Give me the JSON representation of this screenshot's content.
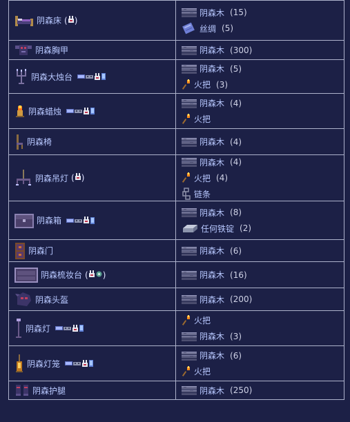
{
  "rows": [
    {
      "item": {
        "name": "阴森床",
        "icon": "spooky-bed-icon",
        "extra": "pre"
      },
      "ingredients": [
        {
          "name": "阴森木",
          "qty": "(15)",
          "icon": "wood-icon"
        },
        {
          "name": "丝绸",
          "qty": "(5)",
          "icon": "silk-icon"
        }
      ]
    },
    {
      "item": {
        "name": "阴森胸甲",
        "icon": "breastplate-icon"
      },
      "ingredients": [
        {
          "name": "阴森木",
          "qty": "(300)",
          "icon": "wood-icon"
        }
      ]
    },
    {
      "item": {
        "name": "阴森大烛台",
        "icon": "candelabra-icon",
        "extra": "platforms"
      },
      "ingredients": [
        {
          "name": "阴森木",
          "qty": "(5)",
          "icon": "wood-icon"
        },
        {
          "name": "火把",
          "qty": "(3)",
          "icon": "torch-icon"
        }
      ]
    },
    {
      "item": {
        "name": "阴森蜡烛",
        "icon": "candle-icon",
        "extra": "platforms"
      },
      "ingredients": [
        {
          "name": "阴森木",
          "qty": "(4)",
          "icon": "wood-icon"
        },
        {
          "name": "火把",
          "qty": "",
          "icon": "torch-icon"
        }
      ]
    },
    {
      "item": {
        "name": "阴森椅",
        "icon": "chair-icon"
      },
      "ingredients": [
        {
          "name": "阴森木",
          "qty": "(4)",
          "icon": "wood-icon"
        }
      ]
    },
    {
      "item": {
        "name": "阴森吊灯",
        "icon": "chandelier-icon",
        "extra": "pre"
      },
      "ingredients": [
        {
          "name": "阴森木",
          "qty": "(4)",
          "icon": "wood-icon"
        },
        {
          "name": "火把",
          "qty": "(4)",
          "icon": "torch-icon"
        },
        {
          "name": "链条",
          "qty": "",
          "icon": "chain-icon"
        }
      ]
    },
    {
      "item": {
        "name": "阴森箱",
        "icon": "chest-icon",
        "extra": "platforms"
      },
      "ingredients": [
        {
          "name": "阴森木",
          "qty": "(8)",
          "icon": "wood-icon"
        },
        {
          "name": "任何铁锭",
          "qty": "(2)",
          "icon": "iron-bar-icon"
        }
      ]
    },
    {
      "item": {
        "name": "阴森门",
        "icon": "door-icon"
      },
      "ingredients": [
        {
          "name": "阴森木",
          "qty": "(6)",
          "icon": "wood-icon"
        }
      ]
    },
    {
      "item": {
        "name": "阴森梳妆台",
        "icon": "dresser-icon",
        "extra": "both"
      },
      "ingredients": [
        {
          "name": "阴森木",
          "qty": "(16)",
          "icon": "wood-icon"
        }
      ]
    },
    {
      "item": {
        "name": "阴森头盔",
        "icon": "helmet-icon"
      },
      "ingredients": [
        {
          "name": "阴森木",
          "qty": "(200)",
          "icon": "wood-icon"
        }
      ]
    },
    {
      "item": {
        "name": "阴森灯",
        "icon": "lamp-icon",
        "extra": "platforms"
      },
      "ingredients": [
        {
          "name": "火把",
          "qty": "",
          "icon": "torch-icon"
        },
        {
          "name": "阴森木",
          "qty": "(3)",
          "icon": "wood-icon"
        }
      ]
    },
    {
      "item": {
        "name": "阴森灯笼",
        "icon": "lantern-icon",
        "extra": "platforms"
      },
      "ingredients": [
        {
          "name": "阴森木",
          "qty": "(6)",
          "icon": "wood-icon"
        },
        {
          "name": "火把",
          "qty": "",
          "icon": "torch-icon"
        }
      ]
    },
    {
      "item": {
        "name": "阴森护腿",
        "icon": "greaves-icon"
      },
      "ingredients": [
        {
          "name": "阴森木",
          "qty": "(250)",
          "icon": "wood-icon"
        }
      ]
    }
  ],
  "punct": {
    "open": "(",
    "close": ")"
  },
  "colors": {
    "background": "#1c2046",
    "border": "#aeb3cc",
    "text": "#ffffff"
  }
}
